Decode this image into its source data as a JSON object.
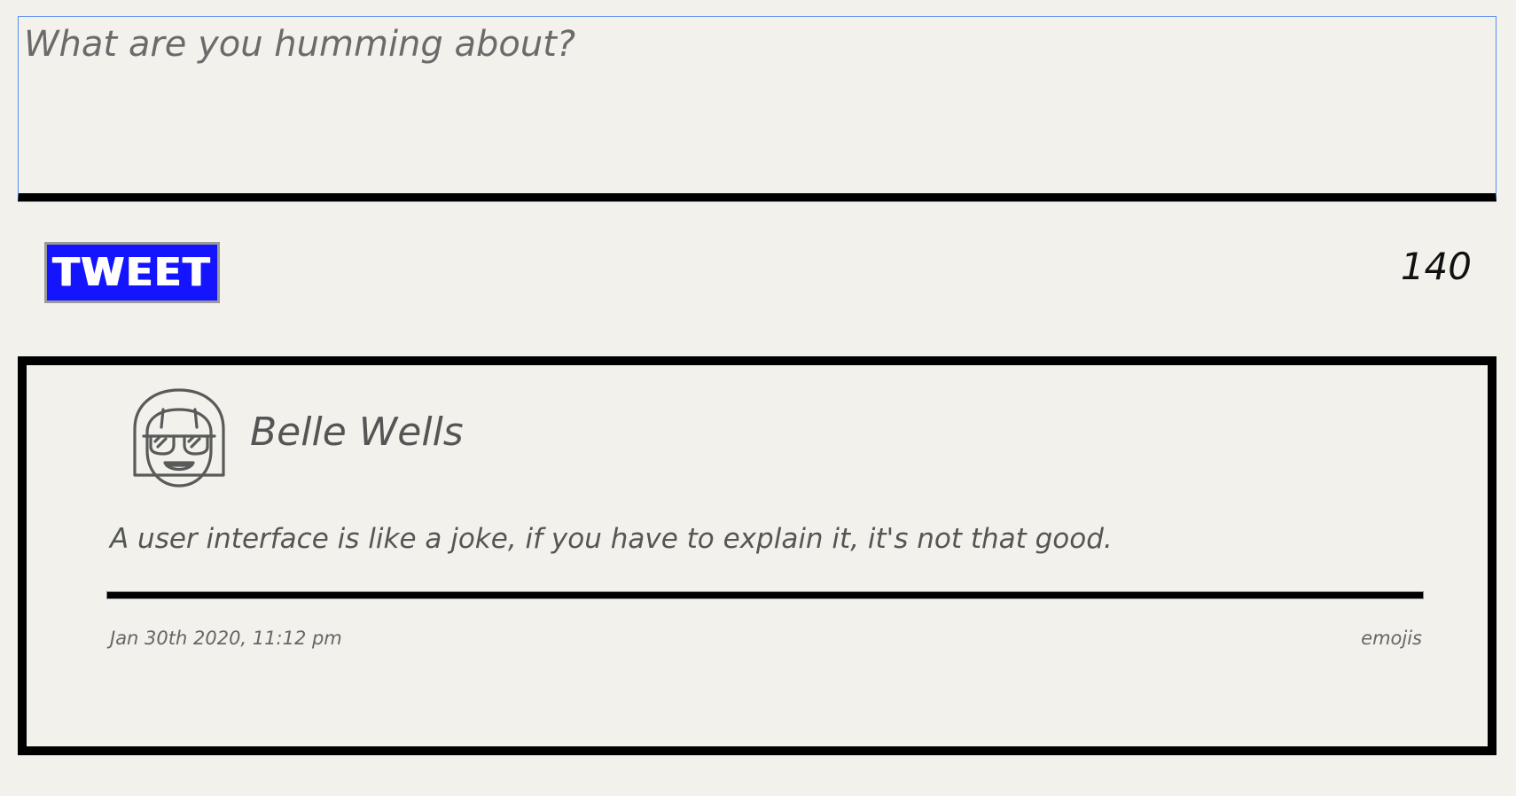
{
  "compose": {
    "placeholder": "What are you humming about?",
    "value": ""
  },
  "toolbar": {
    "tweet_label": "TWEET",
    "char_count": "140"
  },
  "tweet": {
    "author": "Belle Wells",
    "avatar_icon": "avatar-sunglasses-girl-icon",
    "content": "A user interface is like a joke, if you have to explain it, it's not that good.",
    "timestamp": "Jan 30th 2020, 11:12 pm",
    "reactions_label": "emojis"
  }
}
